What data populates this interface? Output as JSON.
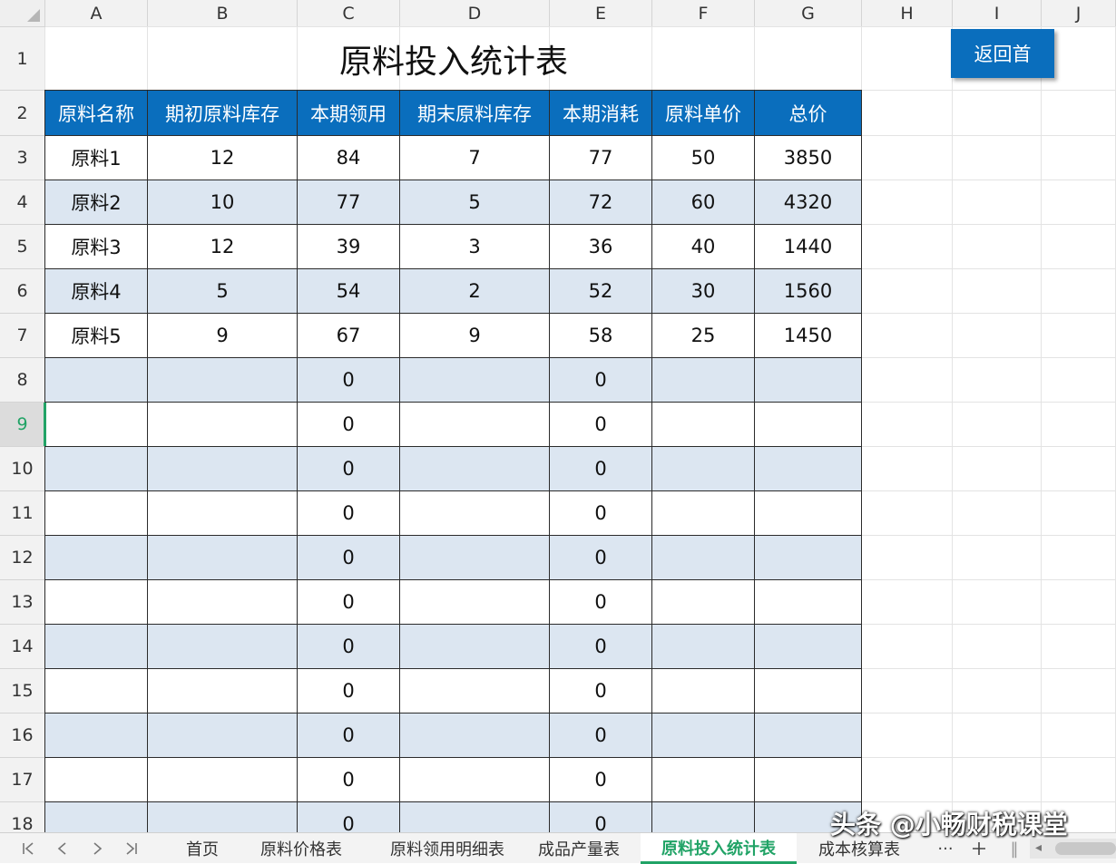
{
  "columns": [
    "A",
    "B",
    "C",
    "D",
    "E",
    "F",
    "G",
    "H",
    "I",
    "J"
  ],
  "rows": [
    "1",
    "2",
    "3",
    "4",
    "5",
    "6",
    "7",
    "8",
    "9",
    "10",
    "11",
    "12",
    "13",
    "14",
    "15",
    "16",
    "17",
    "18"
  ],
  "title": "原料投入统计表",
  "back_button": "返回首",
  "table": {
    "headers": [
      "原料名称",
      "期初原料库存",
      "本期领用",
      "期末原料库存",
      "本期消耗",
      "原料单价",
      "总价"
    ],
    "rows": [
      [
        "原料1",
        "12",
        "84",
        "7",
        "77",
        "50",
        "3850"
      ],
      [
        "原料2",
        "10",
        "77",
        "5",
        "72",
        "60",
        "4320"
      ],
      [
        "原料3",
        "12",
        "39",
        "3",
        "36",
        "40",
        "1440"
      ],
      [
        "原料4",
        "5",
        "54",
        "2",
        "52",
        "30",
        "1560"
      ],
      [
        "原料5",
        "9",
        "67",
        "9",
        "58",
        "25",
        "1450"
      ],
      [
        "",
        "",
        "0",
        "",
        "0",
        "",
        ""
      ],
      [
        "",
        "",
        "0",
        "",
        "0",
        "",
        ""
      ],
      [
        "",
        "",
        "0",
        "",
        "0",
        "",
        ""
      ],
      [
        "",
        "",
        "0",
        "",
        "0",
        "",
        ""
      ],
      [
        "",
        "",
        "0",
        "",
        "0",
        "",
        ""
      ],
      [
        "",
        "",
        "0",
        "",
        "0",
        "",
        ""
      ],
      [
        "",
        "",
        "0",
        "",
        "0",
        "",
        ""
      ],
      [
        "",
        "",
        "0",
        "",
        "0",
        "",
        ""
      ],
      [
        "",
        "",
        "0",
        "",
        "0",
        "",
        ""
      ],
      [
        "",
        "",
        "0",
        "",
        "0",
        "",
        ""
      ],
      [
        "",
        "",
        "0",
        "",
        "0",
        "",
        ""
      ]
    ]
  },
  "active_row": "9",
  "sheet_tabs": [
    "首页",
    "原料价格表",
    "原料领用明细表",
    "成品产量表",
    "原料投入统计表",
    "成本核算表"
  ],
  "active_tab": "原料投入统计表",
  "more_label": "···",
  "watermark": "头条 @小畅财税课堂",
  "colors": {
    "header_blue": "#0a6ebd",
    "alt_row": "#dce6f1",
    "accent_green": "#21a366"
  }
}
